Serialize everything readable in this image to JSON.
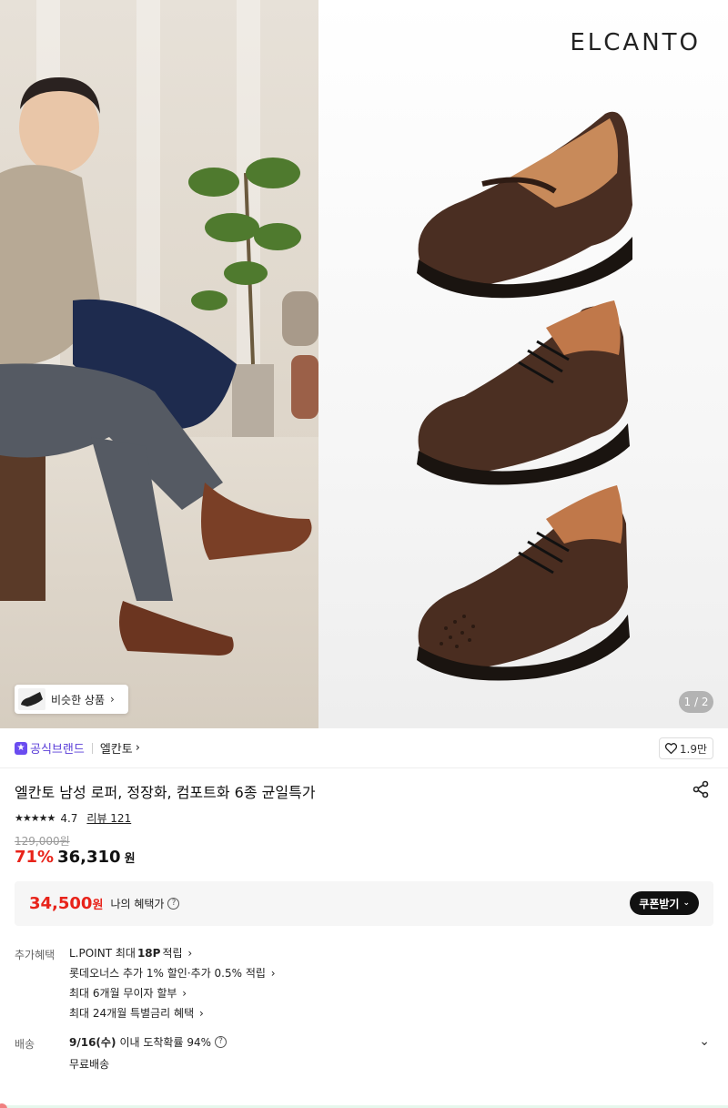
{
  "hero": {
    "brand_logo": "ELCANTO",
    "page_indicator": "1 / 2",
    "similar_button_label": "비슷한 상품"
  },
  "brand_row": {
    "official_label": "공식브랜드",
    "brand_name": "엘칸토",
    "like_count": "1.9만"
  },
  "product": {
    "title": "엘칸토 남성 로퍼, 정장화, 컴포트화 6종 균일특가",
    "rating": "4.7",
    "review_label": "리뷰 121",
    "original_price": "129,000원",
    "discount": "71%",
    "price": "36,310",
    "won": "원"
  },
  "benefit": {
    "price": "34,500",
    "won": "원",
    "label": "나의 혜택가",
    "coupon_button": "쿠폰받기"
  },
  "extra_benefits": {
    "label": "추가혜택",
    "items": [
      {
        "prefix": "L.POINT 최대 ",
        "bold": "18P",
        "suffix": " 적립"
      },
      {
        "prefix": "롯데오너스 추가 1% 할인·추가 0.5% 적립",
        "bold": "",
        "suffix": ""
      },
      {
        "prefix": "최대 6개월 무이자 할부",
        "bold": "",
        "suffix": ""
      },
      {
        "prefix": "최대 24개월 특별금리 혜택",
        "bold": "",
        "suffix": ""
      }
    ]
  },
  "shipping": {
    "label": "배송",
    "date": "9/16(수)",
    "date_suffix": " 이내 도착확률 94%",
    "sub": "무료배송"
  },
  "colors": {
    "discount_red": "#e8231a",
    "official_purple": "#5a3dd8",
    "shoe_brown": "#4a2e22"
  }
}
